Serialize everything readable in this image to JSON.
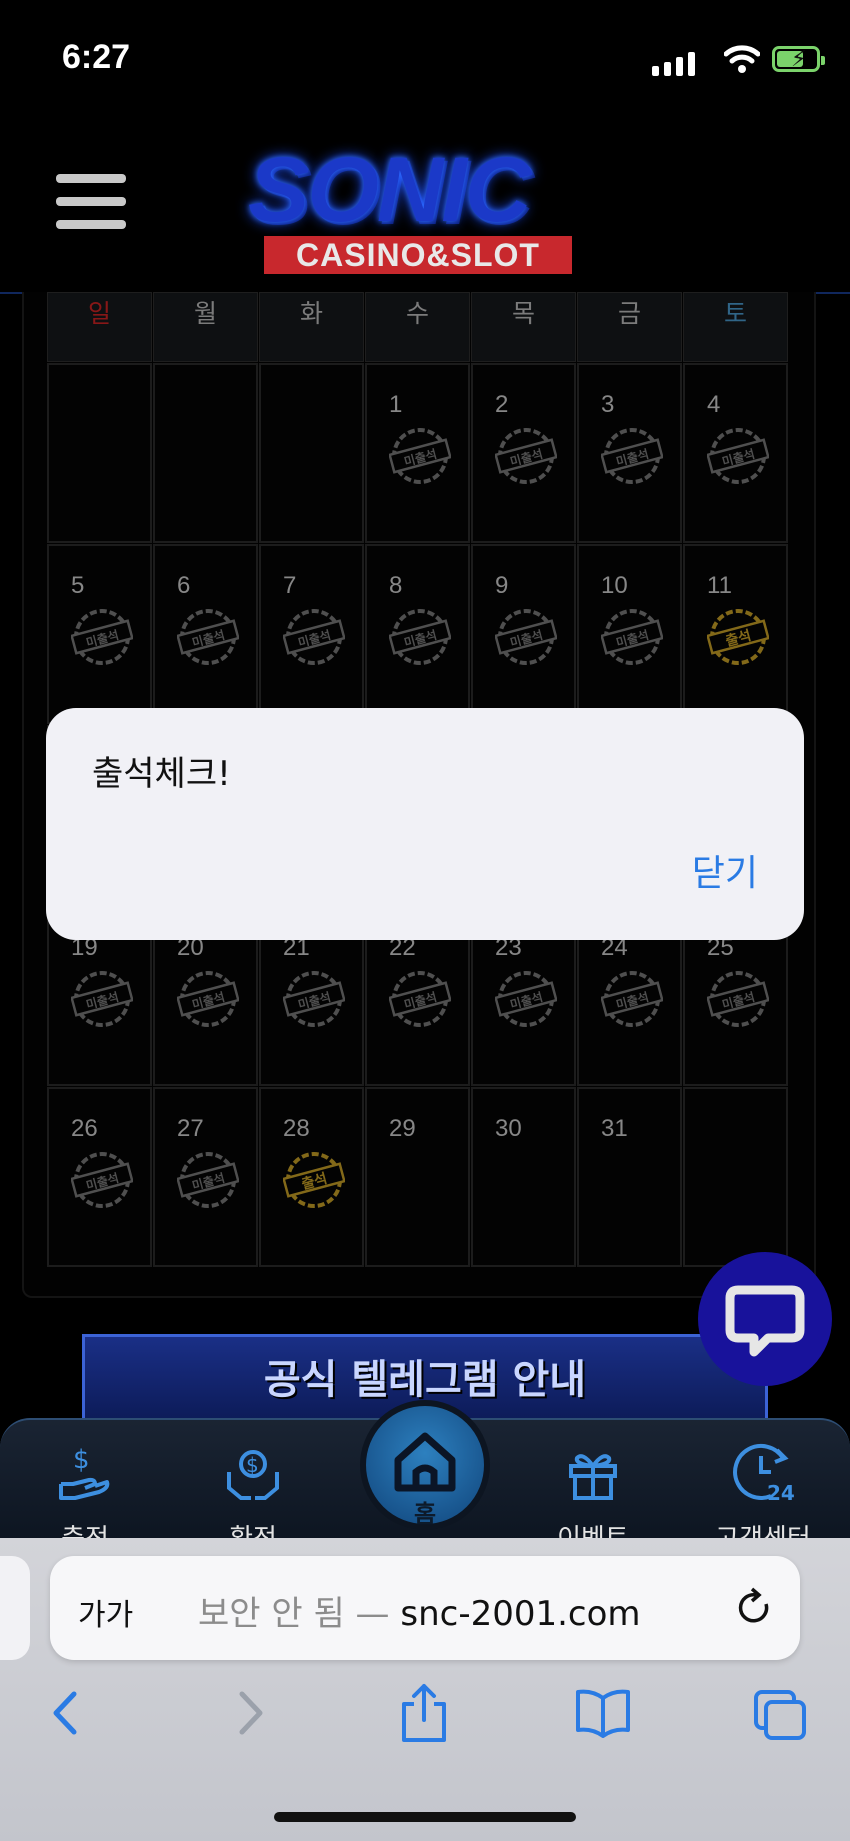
{
  "status_bar": {
    "time": "6:27"
  },
  "header": {
    "logo_main": "SONIC",
    "logo_sub": "CASINO&SLOT"
  },
  "calendar": {
    "weekdays": [
      "일",
      "월",
      "화",
      "수",
      "목",
      "금",
      "토"
    ],
    "weeks": [
      [
        {
          "day": "",
          "stamp": ""
        },
        {
          "day": "",
          "stamp": ""
        },
        {
          "day": "",
          "stamp": ""
        },
        {
          "day": "1",
          "stamp": "미출석"
        },
        {
          "day": "2",
          "stamp": "미출석"
        },
        {
          "day": "3",
          "stamp": "미출석"
        },
        {
          "day": "4",
          "stamp": "미출석"
        }
      ],
      [
        {
          "day": "5",
          "stamp": "미출석"
        },
        {
          "day": "6",
          "stamp": "미출석"
        },
        {
          "day": "7",
          "stamp": "미출석"
        },
        {
          "day": "8",
          "stamp": "미출석"
        },
        {
          "day": "9",
          "stamp": "미출석"
        },
        {
          "day": "10",
          "stamp": "미출석"
        },
        {
          "day": "11",
          "stamp": "출석"
        }
      ],
      [
        {
          "day": "",
          "stamp": ""
        },
        {
          "day": "",
          "stamp": ""
        },
        {
          "day": "",
          "stamp": ""
        },
        {
          "day": "",
          "stamp": ""
        },
        {
          "day": "",
          "stamp": ""
        },
        {
          "day": "",
          "stamp": ""
        },
        {
          "day": "",
          "stamp": ""
        }
      ],
      [
        {
          "day": "19",
          "stamp": "미출석"
        },
        {
          "day": "20",
          "stamp": "미출석"
        },
        {
          "day": "21",
          "stamp": "미출석"
        },
        {
          "day": "22",
          "stamp": "미출석"
        },
        {
          "day": "23",
          "stamp": "미출석"
        },
        {
          "day": "24",
          "stamp": "미출석"
        },
        {
          "day": "25",
          "stamp": "미출석"
        }
      ],
      [
        {
          "day": "26",
          "stamp": "미출석"
        },
        {
          "day": "27",
          "stamp": "미출석"
        },
        {
          "day": "28",
          "stamp": "출석"
        },
        {
          "day": "29",
          "stamp": ""
        },
        {
          "day": "30",
          "stamp": ""
        },
        {
          "day": "31",
          "stamp": ""
        },
        {
          "day": "",
          "stamp": ""
        }
      ]
    ],
    "colors": {
      "attended": "#c9a227",
      "absent": "#7a7a7a"
    }
  },
  "alert": {
    "title": "출석체크!",
    "close_label": "닫기"
  },
  "banner": {
    "text": "공식 텔레그램 안내"
  },
  "bottom_nav": {
    "items": [
      {
        "label": "충전",
        "icon": "deposit-icon"
      },
      {
        "label": "환전",
        "icon": "withdraw-icon"
      },
      {
        "label": "홈",
        "icon": "home-icon"
      },
      {
        "label": "이벤트",
        "icon": "gift-icon"
      },
      {
        "label": "고객센터",
        "icon": "support-24-icon"
      }
    ]
  },
  "browser": {
    "text_size_label": "가가",
    "insecure_label": "보안 안 됨 —",
    "host": "snc-2001.com"
  }
}
